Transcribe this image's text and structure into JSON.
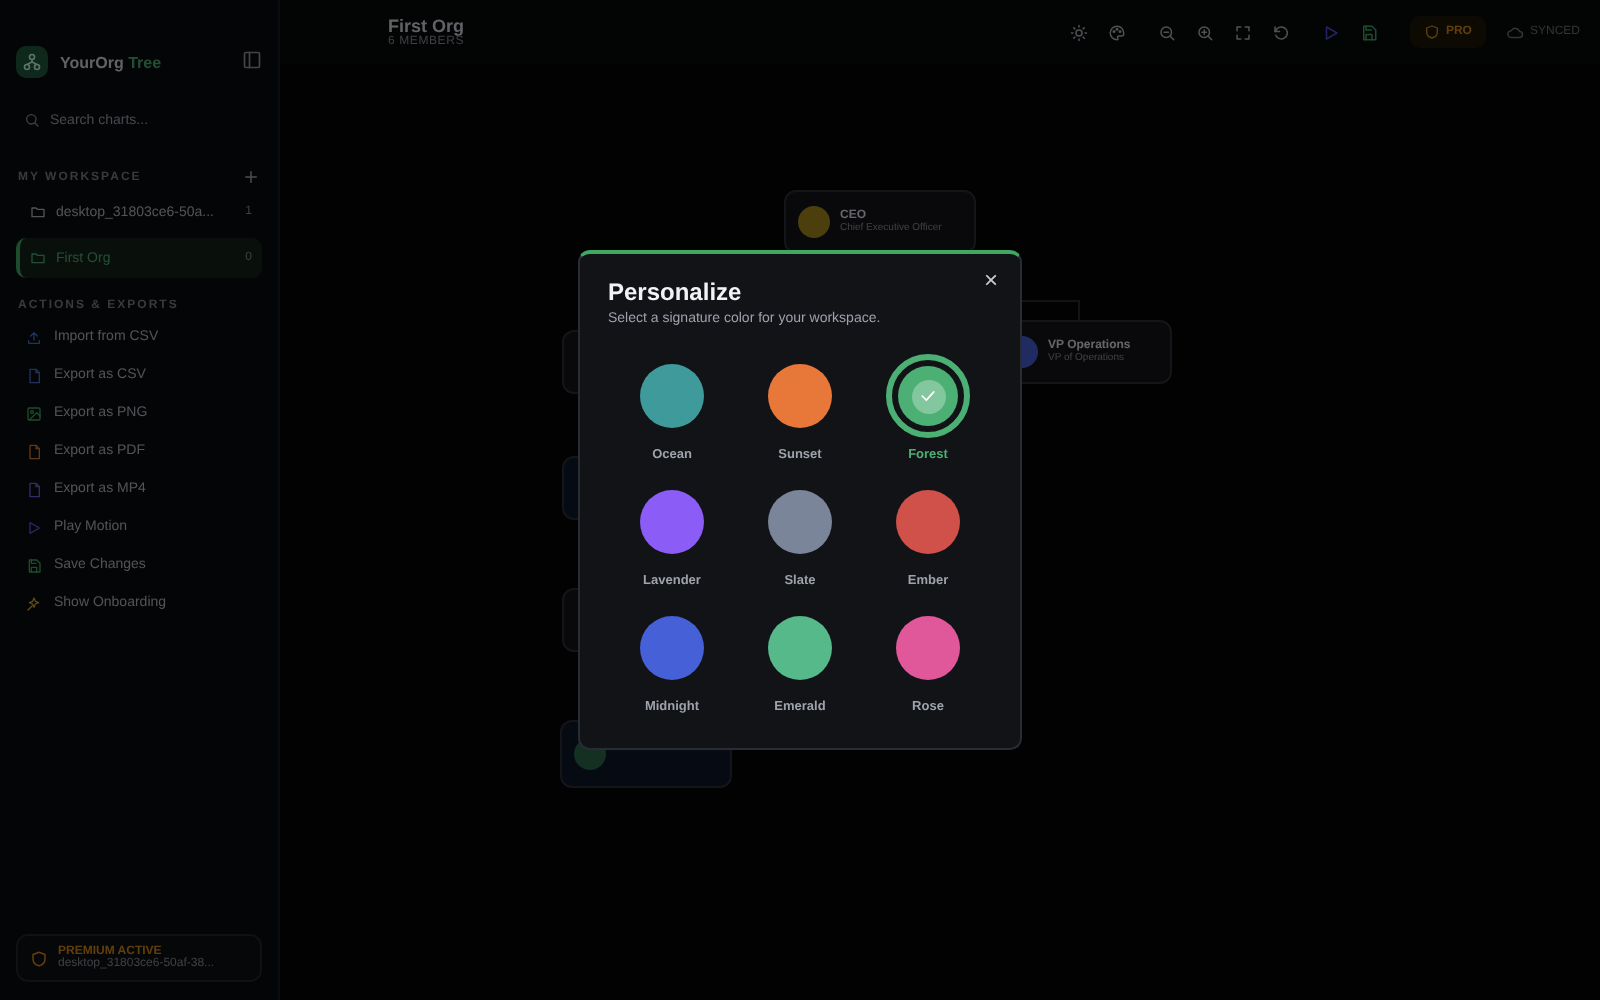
{
  "sidebar": {
    "brand": {
      "name": "YourOrg",
      "accent": "Tree"
    },
    "search": {
      "placeholder": "Search charts..."
    },
    "workspace": {
      "heading": "MY WORKSPACE",
      "items": [
        {
          "label": "desktop_31803ce6-50a...",
          "count": "1",
          "selected": false
        },
        {
          "label": "First Org",
          "count": "0",
          "selected": true
        }
      ]
    },
    "actions": {
      "heading": "ACTIONS & EXPORTS",
      "items": [
        {
          "label": "Import from CSV"
        },
        {
          "label": "Export as CSV"
        },
        {
          "label": "Export as PNG"
        },
        {
          "label": "Export as PDF"
        },
        {
          "label": "Export as MP4"
        },
        {
          "label": "Play Motion"
        },
        {
          "label": "Save Changes"
        },
        {
          "label": "Show Onboarding"
        }
      ]
    },
    "premium": {
      "title": "PREMIUM ACTIVE",
      "detail": "desktop_31803ce6-50af-38..."
    }
  },
  "topbar": {
    "title": "First Org",
    "subtitle": "6 MEMBERS",
    "pro": "PRO",
    "sync": "SYNCED"
  },
  "canvas": {
    "nodes": [
      {
        "name": "CEO",
        "role": "Chief Executive Officer"
      },
      {
        "name": "VP Operations",
        "role": "VP of Operations"
      }
    ]
  },
  "modal": {
    "title": "Personalize",
    "subtitle": "Select a signature color for your workspace.",
    "close": "×",
    "swatches": [
      {
        "label": "Ocean",
        "color": "#3f9a9c",
        "selected": false
      },
      {
        "label": "Sunset",
        "color": "#e8773a",
        "selected": false
      },
      {
        "label": "Forest",
        "color": "#4caf74",
        "selected": true
      },
      {
        "label": "Lavender",
        "color": "#8b5cf6",
        "selected": false
      },
      {
        "label": "Slate",
        "color": "#7a8599",
        "selected": false
      },
      {
        "label": "Ember",
        "color": "#d0504a",
        "selected": false
      },
      {
        "label": "Midnight",
        "color": "#4660d8",
        "selected": false
      },
      {
        "label": "Emerald",
        "color": "#55b98a",
        "selected": false
      },
      {
        "label": "Rose",
        "color": "#e0589a",
        "selected": false
      }
    ]
  }
}
